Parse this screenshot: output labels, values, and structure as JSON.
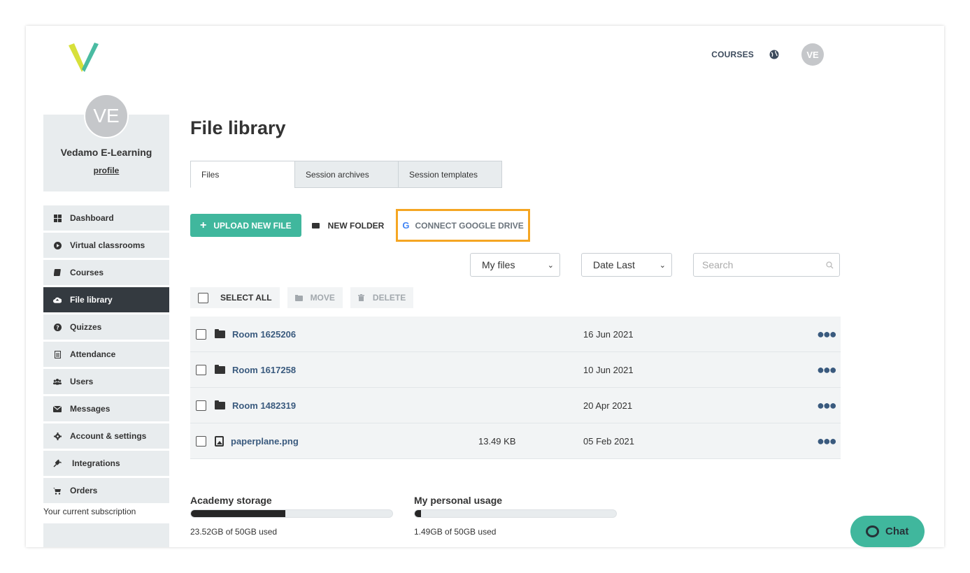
{
  "header": {
    "courses_label": "COURSES",
    "avatar_initials": "VE",
    "logo_colors": [
      "#d7e03a",
      "#40b79d"
    ]
  },
  "profile": {
    "initials": "VE",
    "name": "Vedamo E-Learning",
    "link_label": "profile"
  },
  "sidebar": {
    "items": [
      {
        "label": "Dashboard",
        "icon": "grid-icon",
        "active": false
      },
      {
        "label": "Virtual classrooms",
        "icon": "play-circle-icon",
        "active": false
      },
      {
        "label": "Courses",
        "icon": "book-icon",
        "active": false
      },
      {
        "label": "File library",
        "icon": "cloud-upload-icon",
        "active": true
      },
      {
        "label": "Quizzes",
        "icon": "question-circle-icon",
        "active": false
      },
      {
        "label": "Attendance",
        "icon": "document-icon",
        "active": false
      },
      {
        "label": "Users",
        "icon": "users-icon",
        "active": false
      },
      {
        "label": "Messages",
        "icon": "envelope-icon",
        "active": false
      },
      {
        "label": "Account & settings",
        "icon": "gear-icon",
        "active": false
      },
      {
        "label": "Integrations",
        "icon": "plug-icon",
        "active": false
      },
      {
        "label": "Orders",
        "icon": "cart-icon",
        "active": false
      }
    ],
    "subscription_label": "Your current subscription"
  },
  "main": {
    "title": "File library",
    "tabs": [
      {
        "label": "Files",
        "active": true
      },
      {
        "label": "Session archives",
        "active": false
      },
      {
        "label": "Session templates",
        "active": false
      }
    ],
    "toolbar": {
      "upload_label": "UPLOAD NEW FILE",
      "new_folder_label": "NEW FOLDER",
      "google_drive_label": "CONNECT GOOGLE DRIVE",
      "google_glyph": "G"
    },
    "filters": {
      "owner_value": "My files",
      "sort_value": "Date Last",
      "search_placeholder": "Search"
    },
    "bulk": {
      "select_all_label": "SELECT ALL",
      "move_label": "MOVE",
      "delete_label": "DELETE"
    },
    "files": [
      {
        "name": "Room 1625206",
        "type": "folder",
        "size": "",
        "date": "16 Jun 2021"
      },
      {
        "name": "Room 1617258",
        "type": "folder",
        "size": "",
        "date": "10 Jun 2021"
      },
      {
        "name": "Room 1482319",
        "type": "folder",
        "size": "",
        "date": "20 Apr 2021"
      },
      {
        "name": "paperplane.png",
        "type": "image",
        "size": "13.49 KB",
        "date": "05 Feb 2021"
      }
    ],
    "storage": {
      "academy": {
        "title": "Academy storage",
        "text": "23.52GB of 50GB used",
        "fraction": 0.47
      },
      "personal": {
        "title": "My personal usage",
        "text": "1.49GB of 50GB used",
        "fraction": 0.03
      }
    }
  },
  "chat": {
    "label": "Chat"
  },
  "colors": {
    "accent": "#40b79d",
    "highlight": "#f5a623",
    "link": "#3a5a7e",
    "active_nav": "#343a40"
  }
}
